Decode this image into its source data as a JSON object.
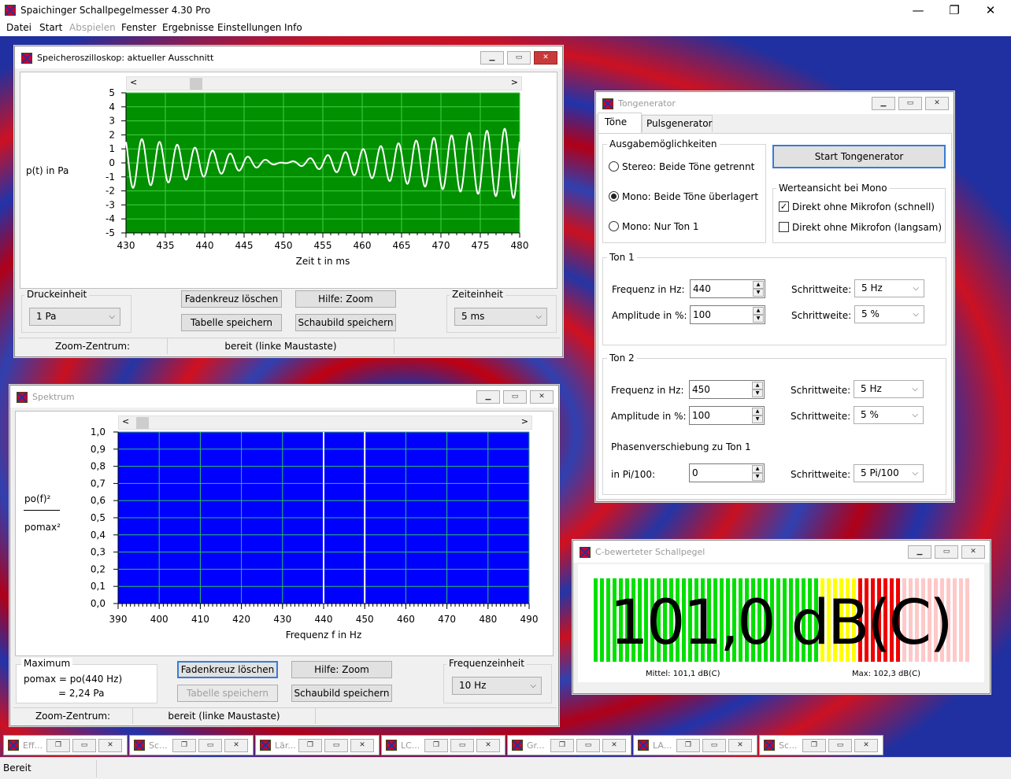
{
  "app": {
    "title": "Spaichinger Schallpegelmesser 4.30 Pro",
    "min": "—",
    "max": "❐",
    "close": "✕"
  },
  "menu": [
    "Datei",
    "Start",
    "Abspielen",
    "Fenster",
    "Ergebnisse",
    "Einstellungen",
    "Info"
  ],
  "osc": {
    "title": "Speicheroszilloskop: aktueller Ausschnitt",
    "ylabel": "p(t) in Pa",
    "xlabel": "Zeit t in ms",
    "scroll_left": "<",
    "scroll_right": ">",
    "druck_label": "Druckeinheit",
    "druck_value": "1 Pa",
    "btn_fadenkreuz": "Fadenkreuz löschen",
    "btn_hilfe": "Hilfe: Zoom",
    "btn_tabelle": "Tabelle speichern",
    "btn_schaubild": "Schaubild speichern",
    "zeit_label": "Zeiteinheit",
    "zeit_value": "5 ms",
    "status_zoom": "Zoom-Zentrum:",
    "status_ready": "bereit (linke Maustaste)"
  },
  "spec": {
    "title": "Spektrum",
    "ylabel_top": "po(f)²",
    "ylabel_bottom": "pomax²",
    "xlabel": "Frequenz f in Hz",
    "scroll_left": "<",
    "scroll_right": ">",
    "max_label": "Maximum",
    "max_line1": "pomax = po(440 Hz)",
    "max_line2": "= 2,24 Pa",
    "btn_fadenkreuz": "Fadenkreuz löschen",
    "btn_hilfe": "Hilfe: Zoom",
    "btn_tabelle": "Tabelle speichern",
    "btn_schaubild": "Schaubild speichern",
    "freq_label": "Frequenzeinheit",
    "freq_value": "10 Hz",
    "status_zoom": "Zoom-Zentrum:",
    "status_ready": "bereit (linke Maustaste)"
  },
  "tone": {
    "title": "Tongenerator",
    "tab1": "Töne",
    "tab2": "Pulsgenerator",
    "ausgabe_label": "Ausgabemöglichkeiten",
    "opt_stereo": "Stereo: Beide Töne getrennt",
    "opt_mono_both": "Mono: Beide Töne überlagert",
    "opt_mono_one": "Mono: Nur Ton 1",
    "start_btn": "Start Tongenerator",
    "werte_label": "Werteansicht bei Mono",
    "chk_fast": "Direkt ohne Mikrofon (schnell)",
    "chk_slow": "Direkt ohne Mikrofon (langsam)",
    "ton1_label": "Ton 1",
    "ton2_label": "Ton 2",
    "freq_label": "Frequenz in Hz:",
    "amp_label": "Amplitude in %:",
    "step_label": "Schrittweite:",
    "t1_freq": "440",
    "t1_amp": "100",
    "t1_step_f": "5 Hz",
    "t1_step_a": "5 %",
    "t2_freq": "450",
    "t2_amp": "100",
    "t2_step_f": "5 Hz",
    "t2_step_a": "5 %",
    "phase_label": "Phasenverschiebung zu Ton 1",
    "phase_unit": "in Pi/100:",
    "phase_val": "0",
    "phase_step": "5 Pi/100"
  },
  "meter": {
    "title": "C-bewerteter Schallpegel",
    "value": "101,0 dB(C)",
    "mittel": "Mittel: 101,1 dB(C)",
    "max": "Max: 102,3 dB(C)"
  },
  "minimized": [
    "Eff...",
    "Sc...",
    "Lär...",
    "LC...",
    "Gr...",
    "LA...",
    "Sc..."
  ],
  "status": "Bereit",
  "chart_data": [
    {
      "type": "line",
      "title": "Speicheroszilloskop: aktueller Ausschnitt",
      "xlabel": "Zeit t in ms",
      "ylabel": "p(t) in Pa",
      "xlim": [
        430,
        480
      ],
      "ylim": [
        -5,
        5
      ],
      "x_ticks": [
        430,
        435,
        440,
        445,
        450,
        455,
        460,
        465,
        470,
        475,
        480
      ],
      "y_ticks": [
        5,
        4,
        3,
        2,
        1,
        0,
        -1,
        -2,
        -3,
        -4,
        -5
      ],
      "series": [
        {
          "signal": "sum of two sines",
          "f1_hz": 440,
          "f2_hz": 450,
          "amplitude_pa": [
            1.58,
            1.58
          ]
        }
      ],
      "colors": {
        "bg": "#009000",
        "grid": "#40d040",
        "line": "#ffffff"
      }
    },
    {
      "type": "bar",
      "title": "Spektrum",
      "xlabel": "Frequenz f in Hz",
      "ylabel": "po(f)² / pomax²",
      "xlim": [
        390,
        490
      ],
      "ylim": [
        0,
        1
      ],
      "x_ticks": [
        390,
        400,
        410,
        420,
        430,
        440,
        450,
        460,
        470,
        480,
        490
      ],
      "y_ticks": [
        "1,0",
        "0,9",
        "0,8",
        "0,7",
        "0,6",
        "0,5",
        "0,4",
        "0,3",
        "0,2",
        "0,1",
        "0,0"
      ],
      "x": [
        440,
        450
      ],
      "values": [
        1.0,
        1.0
      ],
      "colors": {
        "bg": "#0000ff",
        "grid": "#30c060",
        "bar": "#ffffff"
      }
    }
  ]
}
